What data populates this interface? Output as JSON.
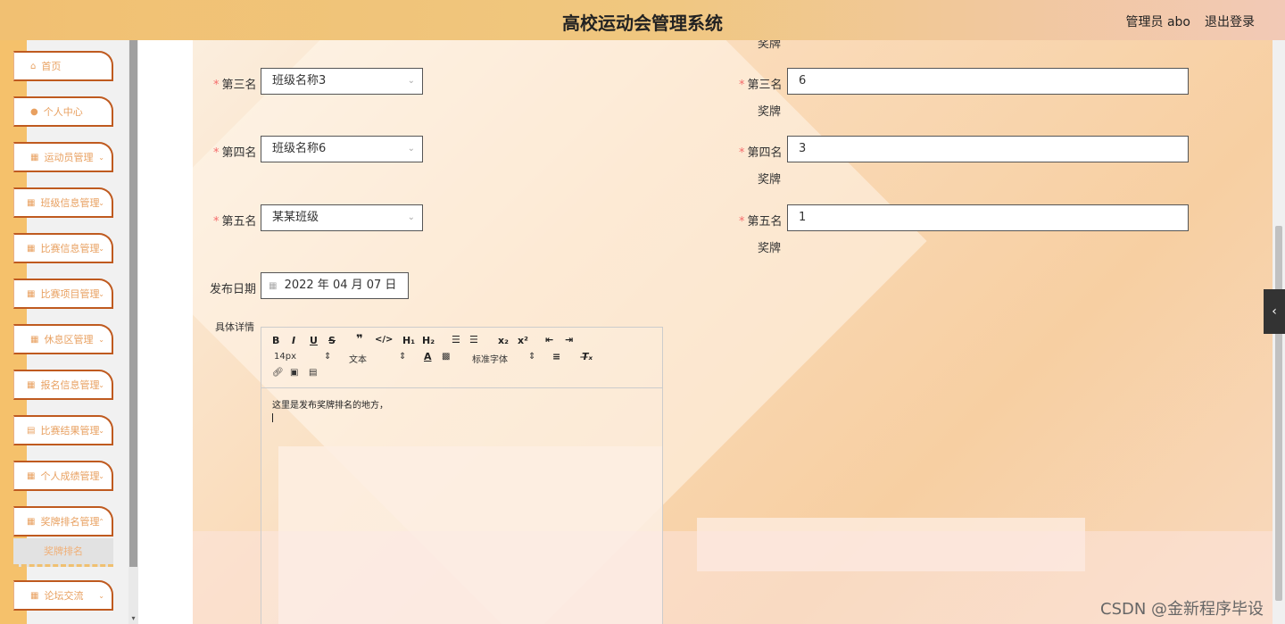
{
  "header": {
    "title": "高校运动会管理系统",
    "user": "管理员 abo",
    "logout": "退出登录"
  },
  "sidebar": {
    "items": [
      {
        "label": "首页",
        "icon": "⌂"
      },
      {
        "label": "个人中心",
        "icon": "●"
      },
      {
        "label": "运动员管理",
        "icon": "▦"
      },
      {
        "label": "班级信息管理",
        "icon": "▦"
      },
      {
        "label": "比赛信息管理",
        "icon": "▦"
      },
      {
        "label": "比赛项目管理",
        "icon": "▦"
      },
      {
        "label": "休息区管理",
        "icon": "▦"
      },
      {
        "label": "报名信息管理",
        "icon": "▦"
      },
      {
        "label": "比赛结果管理",
        "icon": "▤"
      },
      {
        "label": "个人成绩管理",
        "icon": "▦"
      },
      {
        "label": "奖牌排名管理",
        "icon": "▦"
      },
      {
        "label": "论坛交流",
        "icon": "▦"
      }
    ],
    "sub_item": "奖牌排名"
  },
  "form": {
    "top_partial": "奖牌",
    "rows": [
      {
        "rank_label": "第三名",
        "class_value": "班级名称3",
        "medal_label": "第三名",
        "medal_value": "6",
        "medal_suffix": "奖牌"
      },
      {
        "rank_label": "第四名",
        "class_value": "班级名称6",
        "medal_label": "第四名",
        "medal_value": "3",
        "medal_suffix": "奖牌"
      },
      {
        "rank_label": "第五名",
        "class_value": "某某班级",
        "medal_label": "第五名",
        "medal_value": "1",
        "medal_suffix": "奖牌"
      }
    ],
    "date_label": "发布日期",
    "date_value": "2022 年 04 月 07 日",
    "detail_label": "具体详情",
    "editor": {
      "font_size": "14px",
      "text_type": "文本",
      "font_family": "标准字体",
      "content": "这里是发布奖牌排名的地方，"
    }
  },
  "watermark": "CSDN @金新程序毕设"
}
